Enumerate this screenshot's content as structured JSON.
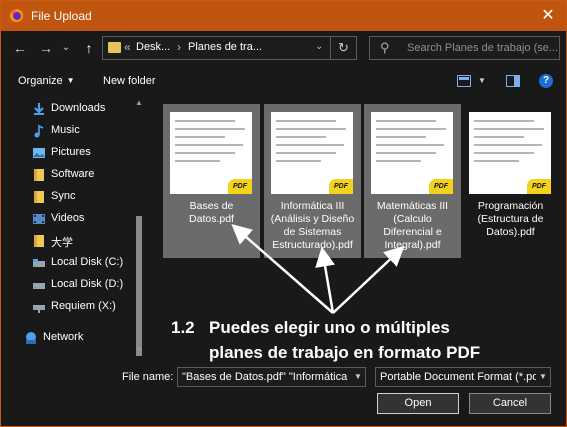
{
  "window": {
    "title": "File Upload",
    "close_glyph": "✕"
  },
  "nav": {
    "back": "←",
    "forward": "→",
    "recent": "⌄",
    "up": "↑"
  },
  "address": {
    "overflow": "«",
    "crumbs": [
      "Desk...",
      "Planes de tra..."
    ],
    "separator": "›",
    "dropdown": "⌄",
    "refresh": "↻"
  },
  "search": {
    "placeholder": "Search Planes de trabajo (se..."
  },
  "toolbar": {
    "organize": "Organize",
    "new_folder": "New folder",
    "help": "?"
  },
  "sidebar": {
    "items": [
      {
        "label": "Downloads",
        "icon": "download-icon"
      },
      {
        "label": "Music",
        "icon": "music-icon"
      },
      {
        "label": "Pictures",
        "icon": "pictures-icon"
      },
      {
        "label": "Software",
        "icon": "folder-icon"
      },
      {
        "label": "Sync",
        "icon": "folder-icon"
      },
      {
        "label": "Videos",
        "icon": "videos-icon"
      },
      {
        "label": "大学",
        "icon": "folder-icon"
      },
      {
        "label": "Local Disk (C:)",
        "icon": "drive-icon"
      },
      {
        "label": "Local Disk (D:)",
        "icon": "drive-icon"
      },
      {
        "label": "Requiem (X:)",
        "icon": "network-drive-icon"
      },
      {
        "label": "Network",
        "icon": "network-icon"
      }
    ]
  },
  "files": [
    {
      "name": "Bases de Datos.pdf",
      "selected": true
    },
    {
      "name": "Informática III (Análisis y Diseño de Sistemas Estructurado).pdf",
      "selected": true
    },
    {
      "name": "Matemáticas III (Calculo Diferencial e Integral).pdf",
      "selected": true
    },
    {
      "name": "Programación (Estructura de Datos).pdf",
      "selected": false
    }
  ],
  "file_badge": "PDF",
  "annotation": {
    "number": "1.2",
    "line1": "Puedes elegir uno o múltiples",
    "line2": "planes de trabajo en formato PDF"
  },
  "footer": {
    "file_name_label": "File name:",
    "file_name_value": "\"Bases de Datos.pdf\" \"Informática",
    "file_type": "Portable Document Format (*.pdf)",
    "open": "Open",
    "cancel": "Cancel"
  },
  "colors": {
    "accent": "#c0550f",
    "selection": "#6b6b6b",
    "pdf_badge": "#f2d21b"
  }
}
